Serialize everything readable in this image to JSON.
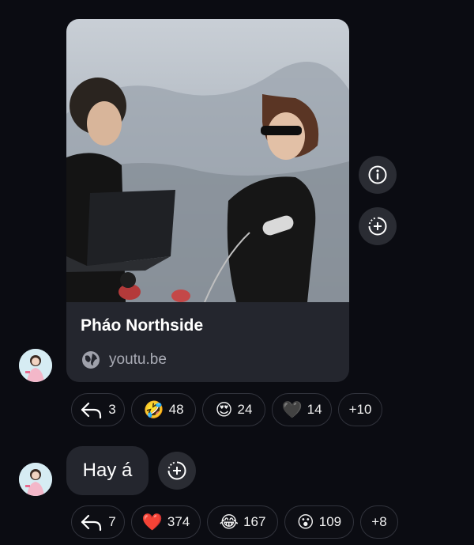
{
  "link_card": {
    "title": "Pháo Northside",
    "domain": "youtu.be",
    "domain_icon": "globe-icon"
  },
  "side_actions": [
    {
      "icon": "info-icon"
    },
    {
      "icon": "add-reaction-icon"
    }
  ],
  "messages": [
    {
      "type": "link",
      "reactions": [
        {
          "icon": "reply-icon",
          "count": "3"
        },
        {
          "emoji": "🤣",
          "count": "48"
        },
        {
          "emoji": "😍",
          "count": "24"
        },
        {
          "emoji": "🖤",
          "count": "14"
        },
        {
          "label": "+10"
        }
      ]
    },
    {
      "type": "text",
      "text": "Hay á",
      "reactions": [
        {
          "icon": "reply-icon",
          "count": "7"
        },
        {
          "emoji": "❤️",
          "count": "374"
        },
        {
          "emoji": "😂",
          "count": "167"
        },
        {
          "emoji": "😮",
          "count": "109"
        },
        {
          "label": "+8"
        }
      ]
    }
  ],
  "colors": {
    "background": "#0b0c12",
    "bubble": "#24262e",
    "pill_border": "#31333c",
    "muted_text": "#a9abb5"
  }
}
